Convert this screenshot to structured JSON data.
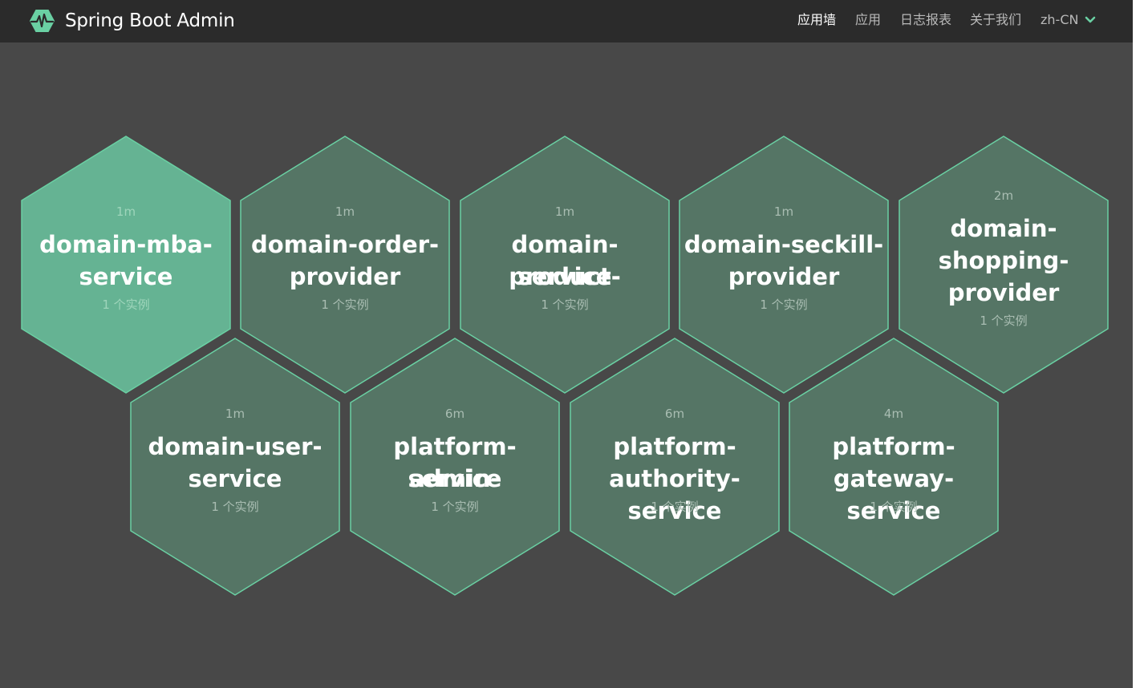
{
  "app": {
    "title": "Spring Boot Admin"
  },
  "nav": {
    "wall": "应用墙",
    "applications": "应用",
    "journal": "日志报表",
    "about": "关于我们",
    "language": "zh-CN"
  },
  "colors": {
    "navbar": "#2b2b2b",
    "background": "#484848",
    "hex_fill": "#557565",
    "hex_fill_active": "#65b393",
    "hex_border": "#6ad0a3"
  },
  "icons": {
    "logo": "spring-boot-admin-heartbeat-logo",
    "language_toggle": "chevron-down-icon"
  },
  "applications": [
    {
      "name_lines": [
        "domain-mba-",
        "service"
      ],
      "time": "1m",
      "instances": "1 个实例",
      "highlighted": true
    },
    {
      "name_lines": [
        "domain-order-",
        "provider"
      ],
      "time": "1m",
      "instances": "1 个实例",
      "highlighted": false
    },
    {
      "name_lines": [
        "domain-product-",
        "service"
      ],
      "time": "1m",
      "instances": "1 个实例",
      "highlighted": false
    },
    {
      "name_lines": [
        "domain-seckill-",
        "provider"
      ],
      "time": "1m",
      "instances": "1 个实例",
      "highlighted": false
    },
    {
      "name_lines": [
        "domain-",
        "shopping-",
        "provider"
      ],
      "time": "2m",
      "instances": "1 个实例",
      "highlighted": false
    },
    {
      "name_lines": [
        "domain-user-",
        "service"
      ],
      "time": "1m",
      "instances": "1 个实例",
      "highlighted": false
    },
    {
      "name_lines": [
        "platform-admin-",
        "service"
      ],
      "time": "6m",
      "instances": "1 个实例",
      "highlighted": false
    },
    {
      "name_lines": [
        "platform-",
        "authority-service"
      ],
      "time": "6m",
      "instances": "1 个实例",
      "highlighted": false
    },
    {
      "name_lines": [
        "platform-",
        "gateway-service"
      ],
      "time": "4m",
      "instances": "1 个实例",
      "highlighted": false
    }
  ]
}
